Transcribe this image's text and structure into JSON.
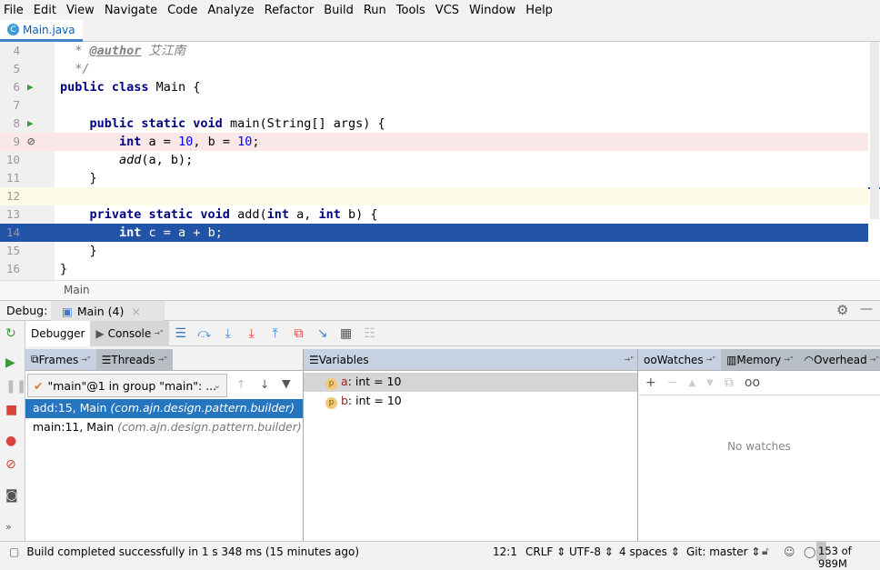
{
  "menu": [
    "File",
    "Edit",
    "View",
    "Navigate",
    "Code",
    "Analyze",
    "Refactor",
    "Build",
    "Run",
    "Tools",
    "VCS",
    "Window",
    "Help"
  ],
  "tab": {
    "label": "Main.java",
    "icon": "java-class-icon"
  },
  "editor": {
    "lines": [
      {
        "n": "4",
        "cls": "",
        "g": "",
        "tokens": [
          {
            "c": "cm",
            "t": "  * "
          },
          {
            "c": "tag",
            "t": "@author"
          },
          {
            "c": "cm",
            "t": " 艾江南"
          }
        ]
      },
      {
        "n": "5",
        "cls": "",
        "g": "",
        "tokens": [
          {
            "c": "cm",
            "t": "  */"
          }
        ]
      },
      {
        "n": "6",
        "cls": "",
        "g": "run",
        "tokens": [
          {
            "c": "k",
            "t": "public class "
          },
          {
            "c": "p",
            "t": "Main {"
          }
        ]
      },
      {
        "n": "7",
        "cls": "",
        "g": "",
        "tokens": []
      },
      {
        "n": "8",
        "cls": "",
        "g": "run",
        "tokens": [
          {
            "c": "k",
            "t": "    public static void "
          },
          {
            "c": "p",
            "t": "main(String[] args) {"
          }
        ]
      },
      {
        "n": "9",
        "cls": "bp",
        "g": "bp",
        "tokens": [
          {
            "c": "k",
            "t": "        int "
          },
          {
            "c": "p",
            "t": "a = "
          },
          {
            "c": "n",
            "t": "10"
          },
          {
            "c": "p",
            "t": ", b = "
          },
          {
            "c": "n",
            "t": "10"
          },
          {
            "c": "p",
            "t": ";"
          }
        ]
      },
      {
        "n": "10",
        "cls": "",
        "g": "",
        "tokens": [
          {
            "c": "it",
            "t": "        add"
          },
          {
            "c": "p",
            "t": "(a, b);"
          }
        ]
      },
      {
        "n": "11",
        "cls": "",
        "g": "",
        "tokens": [
          {
            "c": "p",
            "t": "    }"
          }
        ]
      },
      {
        "n": "12",
        "cls": "cur",
        "g": "",
        "tokens": []
      },
      {
        "n": "13",
        "cls": "",
        "g": "",
        "tokens": [
          {
            "c": "k",
            "t": "    private static void "
          },
          {
            "c": "p",
            "t": "add("
          },
          {
            "c": "k",
            "t": "int "
          },
          {
            "c": "p",
            "t": "a, "
          },
          {
            "c": "k",
            "t": "int "
          },
          {
            "c": "p",
            "t": "b) {"
          }
        ]
      },
      {
        "n": "14",
        "cls": "exec",
        "g": "",
        "tokens": [
          {
            "c": "k",
            "t": "        int "
          },
          {
            "c": "p",
            "t": "c = a + b;"
          }
        ]
      },
      {
        "n": "15",
        "cls": "",
        "g": "",
        "tokens": [
          {
            "c": "p",
            "t": "    }"
          }
        ]
      },
      {
        "n": "16",
        "cls": "",
        "g": "",
        "tokens": [
          {
            "c": "p",
            "t": "}"
          }
        ]
      }
    ]
  },
  "breadcrumb": "Main",
  "debug": {
    "label": "Debug:",
    "tab": "Main (4)"
  },
  "toolbar": {
    "debugger": "Debugger",
    "console": "Console"
  },
  "frames": {
    "tabs": [
      "Frames",
      "Threads"
    ],
    "thread": "\"main\"@1 in group \"main\": ...",
    "items": [
      {
        "method": "add:15, Main",
        "pkg": "(com.ajn.design.pattern.builder)",
        "selected": true
      },
      {
        "method": "main:11, Main",
        "pkg": "(com.ajn.design.pattern.builder)",
        "selected": false
      }
    ]
  },
  "variables": {
    "title": "Variables",
    "items": [
      {
        "name": "a",
        "type": ": int",
        "value": " = 10"
      },
      {
        "name": "b",
        "type": ": int",
        "value": " = 10"
      }
    ]
  },
  "watches": {
    "tabs": [
      "Watches",
      "Memory",
      "Overhead"
    ],
    "empty": "No watches"
  },
  "status": {
    "message": "Build completed successfully in 1 s 348 ms (15 minutes ago)",
    "position": "12:1",
    "line_sep": "CRLF",
    "encoding": "UTF-8",
    "indent": "4 spaces",
    "vcs": "Git: master",
    "memory": "153 of 989M",
    "memory_used_fraction": 0.155
  }
}
